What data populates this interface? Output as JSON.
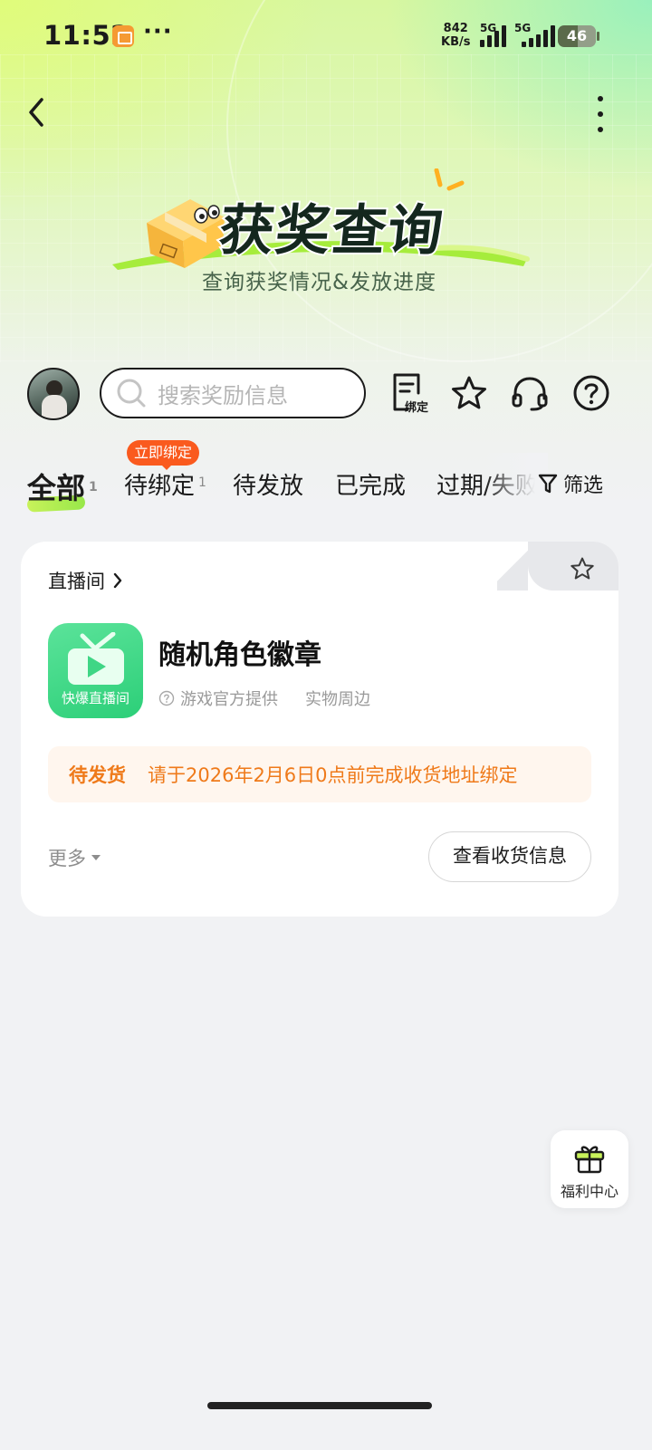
{
  "status_bar": {
    "time": "11:52",
    "dots": "···",
    "net_speed_value": "842",
    "net_speed_unit": "KB/s",
    "signal1_label": "5G",
    "signal2_label": "5G",
    "battery": "46"
  },
  "banner": {
    "title": "获奖查询",
    "subtitle": "查询获奖情况&发放进度"
  },
  "search": {
    "placeholder": "搜索奖励信息"
  },
  "toolbar": {
    "bind_label": "绑定"
  },
  "tabs": {
    "all": {
      "label": "全部",
      "count": "1"
    },
    "pending_bind": {
      "label": "待绑定",
      "count": "1",
      "badge": "立即绑定"
    },
    "pending_issue": {
      "label": "待发放"
    },
    "done": {
      "label": "已完成"
    },
    "expired": {
      "label": "过期/失败"
    },
    "filter": {
      "label": "筛选"
    }
  },
  "card": {
    "source": "直播间",
    "app_name": "快爆直播间",
    "prize_title": "随机角色徽章",
    "provider": "游戏官方提供",
    "category": "实物周边",
    "status": "待发货",
    "status_message": "请于2026年2月6日0点前完成收货地址绑定",
    "more_label": "更多",
    "action_label": "查看收货信息"
  },
  "welfare": {
    "label": "福利中心"
  },
  "colors": {
    "accent_orange": "#ef7a1a",
    "badge_red": "#fa5a1e",
    "app_green": "#2ccf78",
    "lime": "#c8f25a"
  }
}
